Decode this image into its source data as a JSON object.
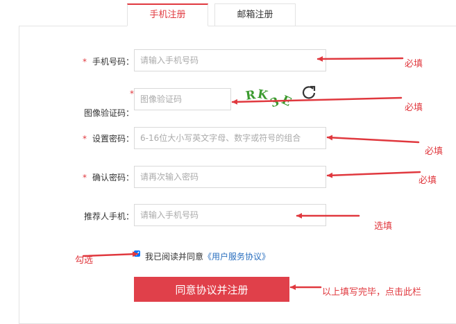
{
  "tabs": {
    "phone": "手机注册",
    "email": "邮箱注册"
  },
  "form": {
    "required_mark": "*",
    "phone": {
      "label": "手机号码：",
      "placeholder": "请输入手机号码"
    },
    "captcha": {
      "label": "图像验证码：",
      "placeholder": "图像验证码",
      "chars": [
        "R",
        "K",
        "3",
        "E"
      ]
    },
    "password": {
      "label": "设置密码：",
      "placeholder": "6-16位大小写英文字母、数字或符号的组合"
    },
    "confirm": {
      "label": "确认密码：",
      "placeholder": "请再次输入密码"
    },
    "referrer": {
      "label": "推荐人手机：",
      "placeholder": "请输入手机号码"
    },
    "agree_prefix": "我已阅读并同意",
    "agree_link": "《用户服务协议》",
    "submit_label": "同意协议并注册"
  },
  "annotations": {
    "required": "必填",
    "optional": "选填",
    "check": "勾选",
    "submit_note": "以上填写完毕，点击此栏",
    "color": "#e0383e"
  },
  "colors": {
    "accent": "#e0383e",
    "submit_bg": "#e0404a",
    "link": "#2a6fbf",
    "captcha": "#3a9a2e"
  },
  "icons": {
    "refresh": "refresh-icon"
  }
}
